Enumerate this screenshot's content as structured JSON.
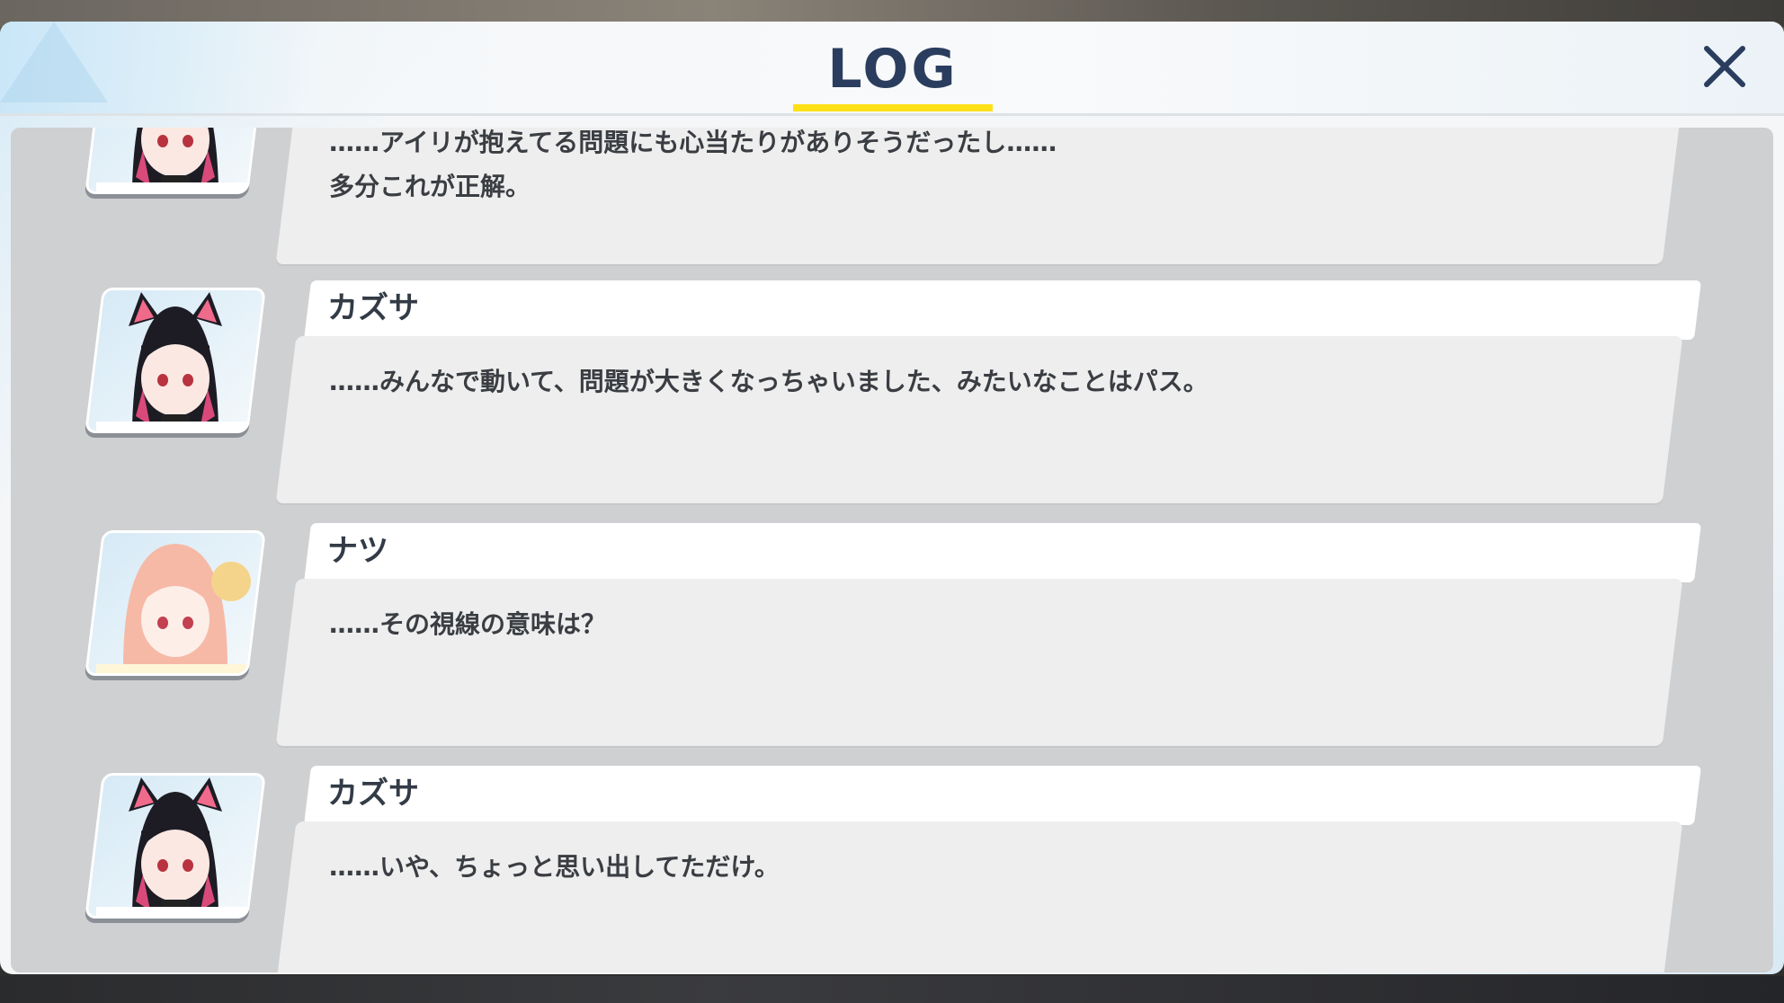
{
  "header": {
    "title": "LOG"
  },
  "entries": [
    {
      "speaker": "",
      "avatar": "kazusa-portrait",
      "text": "……アイリが抱えてる問題にも心当たりがありそうだったし……\n多分これが正解。"
    },
    {
      "speaker": "カズサ",
      "avatar": "kazusa-portrait",
      "text": "……みんなで動いて、問題が大きくなっちゃいました、みたいなことはパス。"
    },
    {
      "speaker": "ナツ",
      "avatar": "natsu-portrait",
      "text": "……その視線の意味は？"
    },
    {
      "speaker": "カズサ",
      "avatar": "kazusa-portrait",
      "text": "……いや、ちょっと思い出してただけ。"
    }
  ],
  "icons": {
    "close": "close-icon"
  },
  "colors": {
    "accent_underline": "#ffe017",
    "title": "#2a3d5e",
    "name_bar": "#ffffff",
    "message_bar": "#eeeeee"
  }
}
